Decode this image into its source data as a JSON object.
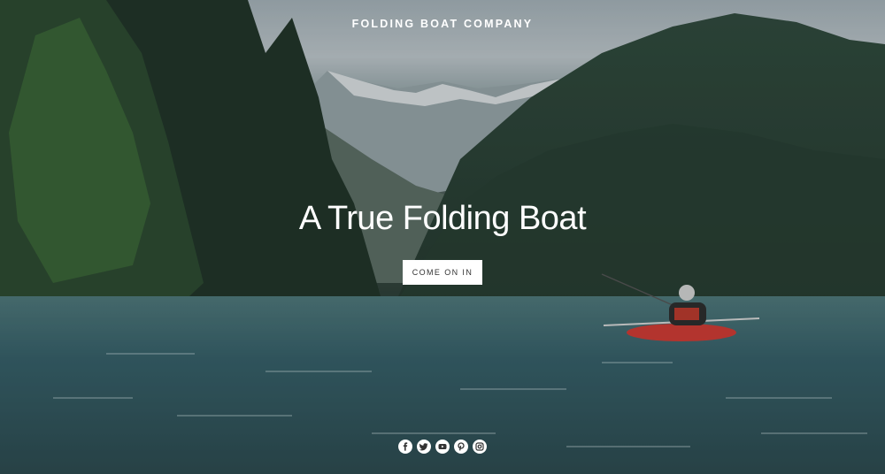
{
  "header": {
    "brand": "FOLDING BOAT COMPANY"
  },
  "hero": {
    "title": "A True Folding Boat",
    "cta_label": "COME ON IN"
  },
  "social": {
    "items": [
      {
        "icon": "facebook-icon"
      },
      {
        "icon": "twitter-icon"
      },
      {
        "icon": "youtube-icon"
      },
      {
        "icon": "pinterest-icon"
      },
      {
        "icon": "instagram-icon"
      }
    ]
  },
  "colors": {
    "overlay_text": "#ffffff",
    "button_bg": "#ffffff",
    "button_text": "#333333"
  }
}
